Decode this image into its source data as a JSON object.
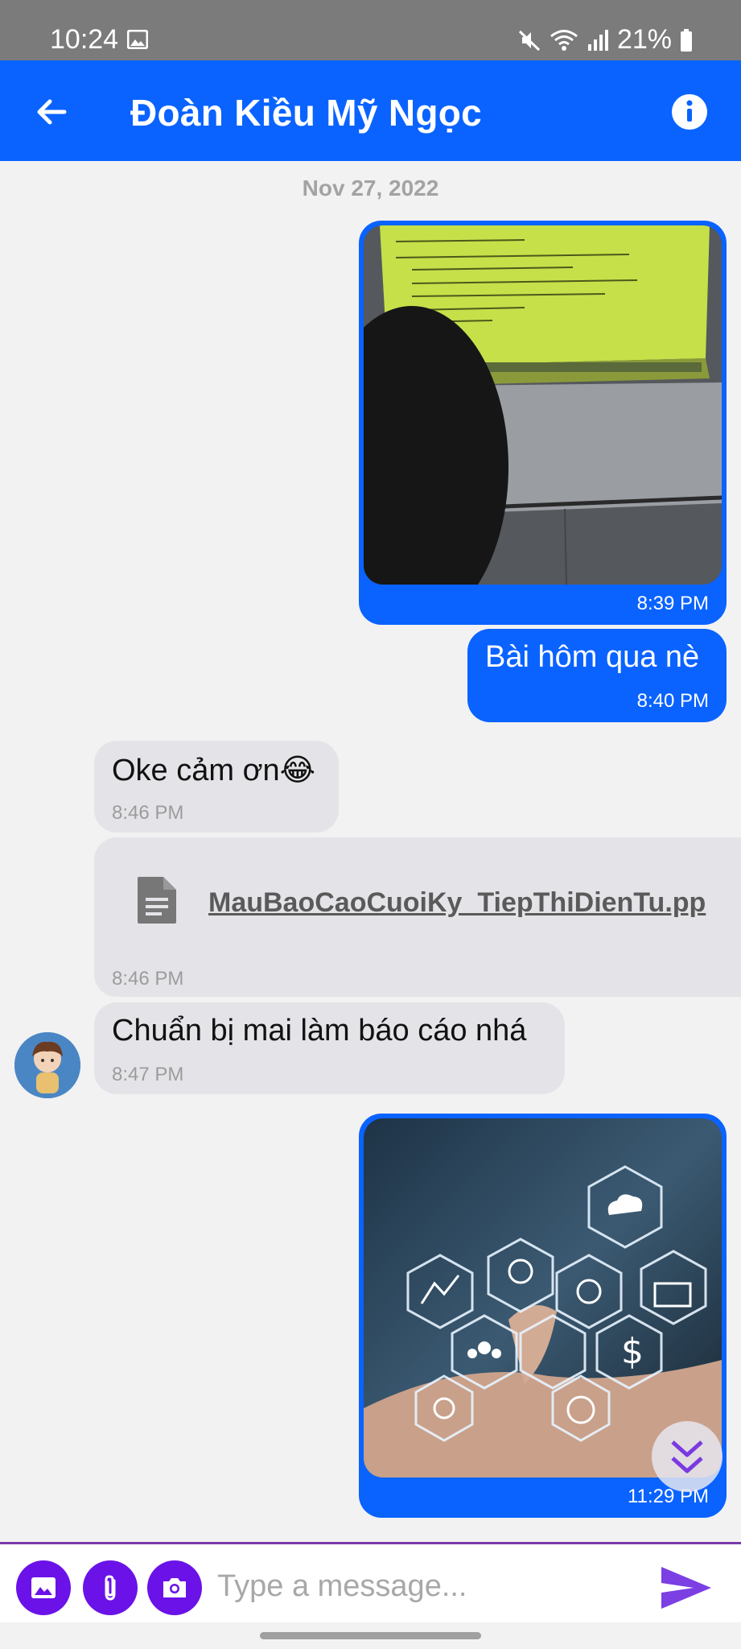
{
  "status_bar": {
    "time": "10:24",
    "battery": "21%",
    "icons": [
      "image-icon",
      "mute-icon",
      "wifi-icon",
      "signal-icon",
      "battery-icon"
    ]
  },
  "header": {
    "title": "Đoàn Kiều Mỹ Ngọc",
    "back_icon": "arrow-left-icon",
    "info_icon": "info-icon"
  },
  "chat": {
    "date_separator": "Nov 27, 2022",
    "messages": [
      {
        "direction": "outgoing",
        "type": "image",
        "image_desc": "projector-code-photo",
        "time": "8:39 PM"
      },
      {
        "direction": "outgoing",
        "type": "text",
        "text": "Bài hôm qua nè",
        "time": "8:40 PM"
      },
      {
        "direction": "incoming",
        "type": "text",
        "text": "Oke cảm ơn😂",
        "time": "8:46 PM"
      },
      {
        "direction": "incoming",
        "type": "file",
        "file_name": "MauBaoCaoCuoiKy_TiepThiDienTu.pp",
        "time": "8:46 PM"
      },
      {
        "direction": "incoming",
        "type": "text",
        "text": "Chuẩn bị mai làm báo cáo nhá",
        "time": "8:47 PM"
      },
      {
        "direction": "outgoing",
        "type": "image",
        "image_desc": "digital-icons-hand-photo",
        "time": "11:29 PM"
      }
    ]
  },
  "composer": {
    "placeholder": "Type a message...",
    "value": "",
    "buttons": [
      "image-icon",
      "attach-icon",
      "camera-icon"
    ],
    "send_icon": "send-icon"
  },
  "colors": {
    "primary": "#0a63ff",
    "action_purple": "#6a12e8",
    "incoming_bubble": "#e4e4e8",
    "background": "#f2f2f2",
    "status_bar": "#7b7b7b"
  }
}
